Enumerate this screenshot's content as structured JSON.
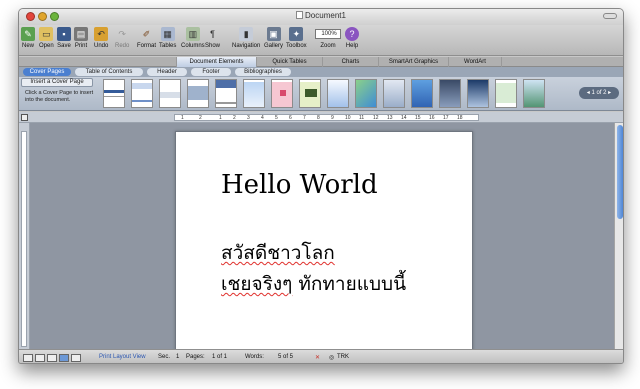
{
  "window": {
    "title": "Document1"
  },
  "toolbar": {
    "new": "New",
    "open": "Open",
    "save": "Save",
    "print": "Print",
    "undo": "Undo",
    "redo": "Redo",
    "format": "Format",
    "tables": "Tables",
    "columns": "Columns",
    "show": "Show",
    "navigation": "Navigation",
    "gallery": "Gallery",
    "toolbox": "Toolbox",
    "zoom": "Zoom",
    "zoom_value": "100%",
    "help": "Help"
  },
  "ribbon_tabs": [
    "Document Elements",
    "Quick Tables",
    "Charts",
    "SmartArt Graphics",
    "WordArt"
  ],
  "sub_tabs": [
    "Cover Pages",
    "Table of Contents",
    "Header",
    "Footer",
    "Bibliographies"
  ],
  "gallery": {
    "insert_button": "Insert a Cover Page",
    "hint": "Click a Cover Page to insert into the document.",
    "pager": "1 of 2"
  },
  "ruler_numbers": [
    "1",
    "2",
    "1",
    "2",
    "3",
    "4",
    "5",
    "6",
    "7",
    "8",
    "9",
    "10",
    "11",
    "12",
    "13",
    "14",
    "15",
    "16",
    "17",
    "18"
  ],
  "document": {
    "line1": "Hello World",
    "line2": "สวัสดีชาวโลก",
    "line3_a": "เชยจริงๆ",
    "line3_b": " ทักทายแบบนี้"
  },
  "status": {
    "view": "Print Layout View",
    "sec_label": "Sec.",
    "sec_value": "1",
    "pages_label": "Pages:",
    "pages_value": "1 of 1",
    "words_label": "Words:",
    "words_value": "5 of 5",
    "trk": "TRK"
  }
}
